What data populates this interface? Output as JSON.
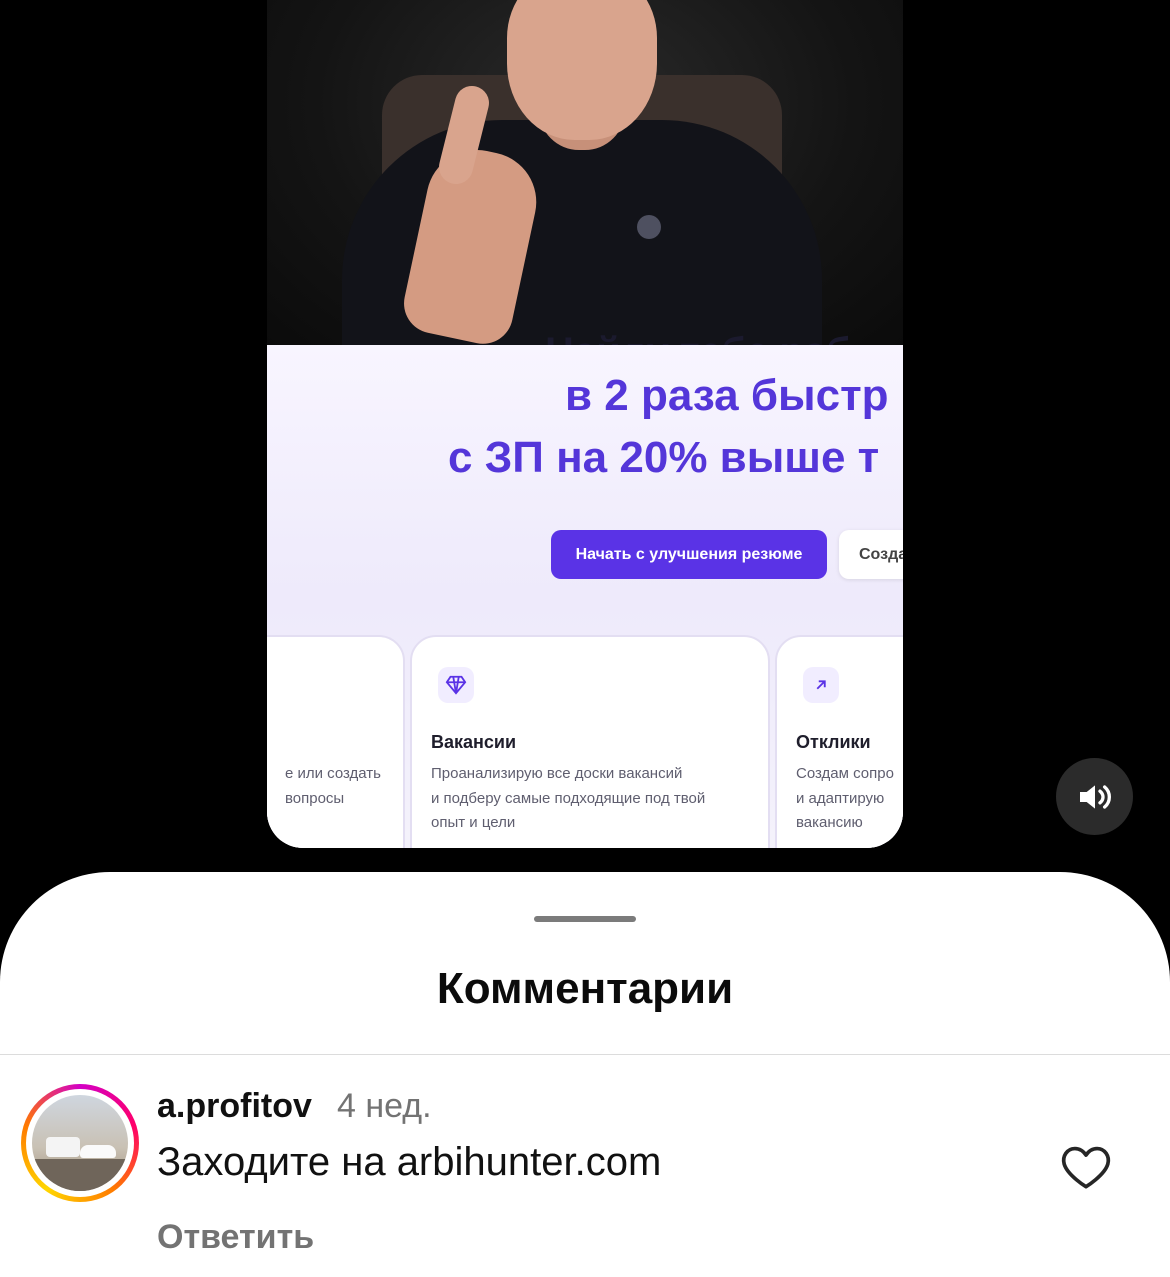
{
  "video": {
    "headline_clip": "Найду тебе раб",
    "headline_line2": "в 2 раза быстр",
    "headline_line3": "с ЗП на 20% выше т",
    "primary_button": "Начать с улучшения резюме",
    "secondary_button": "Созда",
    "cards": [
      {
        "title": "",
        "text": "е или создать\nвопросы"
      },
      {
        "icon": "diamond-icon",
        "title": "Вакансии",
        "text": "Проанализирую все доски вакансий\nи подберу самые подходящие под твой\nопыт и цели"
      },
      {
        "icon": "arrow-up-right-icon",
        "title": "Отклики",
        "text": "Создам сопро\nи адаптирую\nвакансию"
      }
    ]
  },
  "controls": {
    "sound_icon": "speaker-icon"
  },
  "sheet": {
    "title": "Комментарии",
    "comment": {
      "username": "a.profitov",
      "time": "4 нед.",
      "text": "Заходите на arbihunter.com",
      "reply_label": "Ответить",
      "like_icon": "heart-icon"
    }
  },
  "colors": {
    "accent": "#5a33e6",
    "background": "#000000",
    "sheet": "#ffffff",
    "muted_text": "#737373"
  }
}
